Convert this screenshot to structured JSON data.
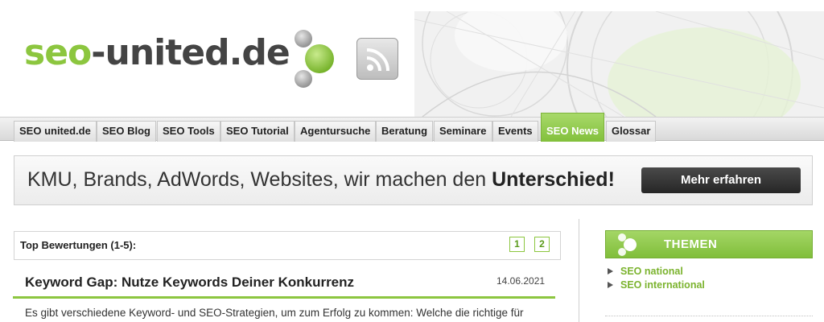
{
  "header": {
    "logo_part1": "seo",
    "logo_part2": "-united.de",
    "rss_icon": "rss-feed-icon"
  },
  "nav": {
    "items": [
      {
        "label": "SEO united.de"
      },
      {
        "label": "SEO Blog"
      },
      {
        "label": "SEO Tools"
      },
      {
        "label": "SEO Tutorial"
      },
      {
        "label": "Agentursuche"
      },
      {
        "label": "Beratung"
      },
      {
        "label": "Seminare"
      },
      {
        "label": "Events"
      },
      {
        "label": "SEO News",
        "active": true
      },
      {
        "label": "Glossar"
      }
    ]
  },
  "banner": {
    "text_plain": "KMU, Brands, AdWords, Websites, wir machen den ",
    "text_bold": "Unterschied!",
    "button_label": "Mehr erfahren"
  },
  "ratings": {
    "title": "Top Bewertungen (1-5):",
    "pages": [
      "1",
      "2"
    ]
  },
  "article": {
    "title": "Keyword Gap: Nutze Keywords Deiner Konkurrenz",
    "date": "14.06.2021",
    "excerpt": "Es gibt verschiedene Keyword- und SEO-Strategien, um zum Erfolg zu kommen: Welche die richtige für"
  },
  "sidebar": {
    "title": "THEMEN",
    "items": [
      {
        "label": "SEO national"
      },
      {
        "label": "SEO international"
      }
    ]
  },
  "colors": {
    "brand_green": "#8cc63f",
    "dark_text": "#444444",
    "button_dark": "#262626"
  }
}
